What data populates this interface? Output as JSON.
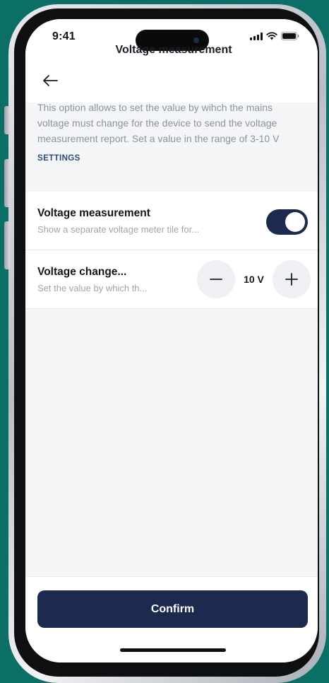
{
  "status_bar": {
    "time": "9:41"
  },
  "header": {
    "title": "Voltage measurement",
    "back_icon": "arrow-left-icon"
  },
  "description": "This option allows to set the value by wihch the mains voltage must change for the device to send the voltage measurement report. Set a value in the range of 3-10 V",
  "section_label": "SETTINGS",
  "settings": [
    {
      "title": "Voltage measurement",
      "subtitle": "Show a separate voltage meter tile for...",
      "control": "toggle",
      "enabled": true
    },
    {
      "title": "Voltage change...",
      "subtitle": "Set the value by which th...",
      "control": "stepper",
      "value": "10 V"
    }
  ],
  "confirm_label": "Confirm",
  "colors": {
    "background": "#0b6f66",
    "accent": "#1d2a4f",
    "section_label": "#2c4a7a",
    "muted_text": "#8d939c"
  }
}
